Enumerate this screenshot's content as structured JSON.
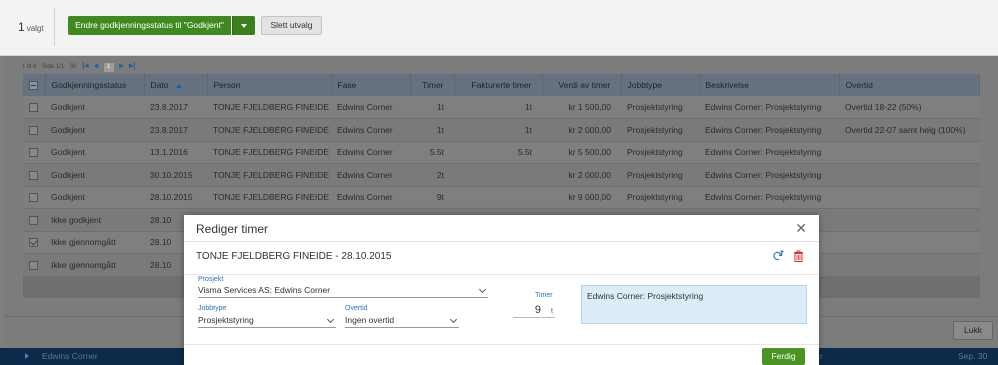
{
  "toolbar": {
    "selected_count": "1",
    "selected_label": "valgt",
    "approve_label": "Endre godkjenningsstatus til \"Godkjent\"",
    "delete_label": "Slett utvalg"
  },
  "pager": {
    "range": "1 til 8",
    "page_of": "Side 1/1",
    "page_size": "30",
    "page": "1"
  },
  "grid": {
    "columns": [
      "Godkjenningsstatus",
      "Dato",
      "Person",
      "Fase",
      "Timer",
      "Fakturerte timer",
      "Verdi av timer",
      "Jobbtype",
      "Beskrivelse",
      "Overtid"
    ],
    "rows": [
      {
        "status": "Godkjent",
        "date": "23.8.2017",
        "person": "TONJE FJELDBERG FINEIDE",
        "phase": "Edwins Corner",
        "hours": "1t",
        "billed": "1t",
        "value": "kr 1 500,00",
        "jobtype": "Prosjektstyring",
        "desc": "Edwins Corner: Prosjektstyring",
        "overtime": "Overtid 18-22 (50%)",
        "checked": false
      },
      {
        "status": "Godkjent",
        "date": "23.8.2017",
        "person": "TONJE FJELDBERG FINEIDE",
        "phase": "Edwins Corner",
        "hours": "1t",
        "billed": "1t",
        "value": "kr 2 000,00",
        "jobtype": "Prosjektstyring",
        "desc": "Edwins Corner: Prosjektstyring",
        "overtime": "Overtid 22-07 samt helg (100%)",
        "checked": false
      },
      {
        "status": "Godkjent",
        "date": "13.1.2016",
        "person": "TONJE FJELDBERG FINEIDE",
        "phase": "Edwins Corner",
        "hours": "5.5t",
        "billed": "5.5t",
        "value": "kr 5 500,00",
        "jobtype": "Prosjektstyring",
        "desc": "Edwins Corner: Prosjektstyring",
        "overtime": "",
        "checked": false
      },
      {
        "status": "Godkjent",
        "date": "30.10.2015",
        "person": "TONJE FJELDBERG FINEIDE",
        "phase": "Edwins Corner",
        "hours": "2t",
        "billed": "",
        "value": "kr 2 000,00",
        "jobtype": "Prosjektstyring",
        "desc": "Edwins Corner: Prosjektstyring",
        "overtime": "",
        "checked": false
      },
      {
        "status": "Godkjent",
        "date": "28.10.2015",
        "person": "TONJE FJELDBERG FINEIDE",
        "phase": "Edwins Corner",
        "hours": "9t",
        "billed": "",
        "value": "kr 9 000,00",
        "jobtype": "Prosjektstyring",
        "desc": "Edwins Corner: Prosjektstyring",
        "overtime": "",
        "checked": false
      },
      {
        "status": "Ikke godkjent",
        "date": "28.10",
        "person": "",
        "phase": "",
        "hours": "",
        "billed": "",
        "value": "",
        "jobtype": "",
        "desc": "",
        "overtime": "",
        "checked": false
      },
      {
        "status": "Ikke gjennomgått",
        "date": "28.10",
        "person": "",
        "phase": "",
        "hours": "",
        "billed": "",
        "value": "",
        "jobtype": "",
        "desc": "",
        "overtime": "",
        "checked": true
      },
      {
        "status": "Ikke gjennomgått",
        "date": "28.10",
        "person": "",
        "phase": "",
        "hours": "",
        "billed": "",
        "value": "",
        "jobtype": "",
        "desc": "",
        "overtime": "",
        "checked": false
      }
    ]
  },
  "footer": {
    "close_label": "Lukk"
  },
  "bottom_strip": {
    "name": "Edwins Corner",
    "right1": "r",
    "right2": "Sep. 30"
  },
  "modal": {
    "title": "Rediger timer",
    "subtitle": "TONJE FJELDBERG FINEIDE - 28.10.2015",
    "project_label": "Prosjekt",
    "project_value": "Visma Services AS: Edwins Corner",
    "jobtype_label": "Jobbtype",
    "jobtype_value": "Prosjektstyring",
    "overtime_label": "Overtid",
    "overtime_value": "Ingen overtid",
    "hours_label": "Timer",
    "hours_value": "9",
    "hours_unit": "t",
    "description": "Edwins Corner: Prosjektstyring",
    "done_label": "Ferdig"
  },
  "colors": {
    "accent_green": "#4a9422",
    "link_blue": "#2a73c2",
    "delete_red": "#d9342b"
  }
}
